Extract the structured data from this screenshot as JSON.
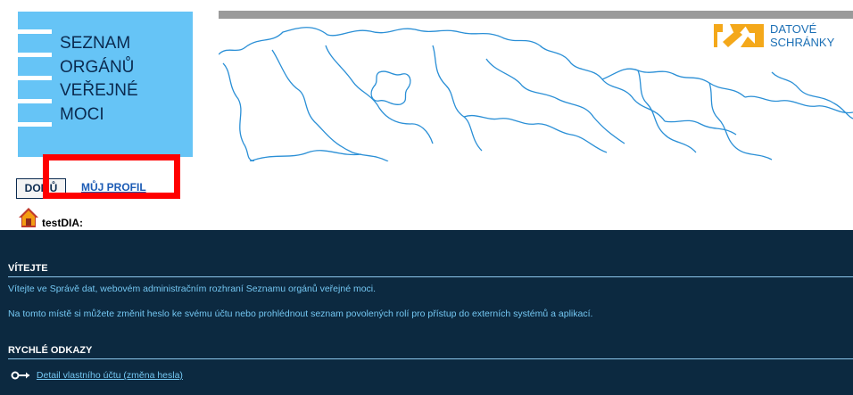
{
  "logo": {
    "lines": [
      "SEZNAM",
      "ORGÁNŮ",
      "VEŘEJNÉ",
      "MOCI"
    ]
  },
  "brand": {
    "line1": "DATOVÉ",
    "line2": "SCHRÁNKY"
  },
  "nav": {
    "home_label": "DOMŮ",
    "profile_label": "MŮJ PROFIL"
  },
  "user": {
    "name": "testDIA:"
  },
  "welcome": {
    "title": "VÍTEJTE",
    "paragraph1": "Vítejte ve Správě dat, webovém administračním rozhraní Seznamu orgánů veřejné moci.",
    "paragraph2": "Na tomto místě si můžete změnit heslo ke svému účtu nebo prohlédnout seznam povolených rolí pro přístup do externích systémů a aplikací."
  },
  "quick_links": {
    "title": "RYCHLÉ ODKAZY",
    "items": [
      {
        "label": "Detail vlastního účtu (změna hesla)",
        "icon": "key-icon"
      }
    ]
  },
  "colors": {
    "panel": "#0c2940",
    "logo_bg": "#66c4f6",
    "accent": "#74c7f2",
    "highlight": "#ff0000"
  }
}
